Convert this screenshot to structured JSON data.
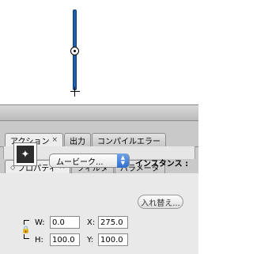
{
  "panel_tabs_top": [
    {
      "label": "アクション",
      "close": "×"
    },
    {
      "label": "出力"
    },
    {
      "label": "コンパイルエラー"
    }
  ],
  "panel_tabs_props": [
    {
      "label": "プロパティ",
      "close": "×",
      "active": true
    },
    {
      "label": "フィルタ"
    },
    {
      "label": "パラメータ"
    }
  ],
  "symbol_type": {
    "selected": "ムービーク..."
  },
  "instance": {
    "label": "インスタンス :"
  },
  "swap_button": {
    "label": "入れ替え..."
  },
  "transform": {
    "w_label": "W:",
    "w_value": "0.0",
    "x_label": "X:",
    "x_value": "275.0",
    "h_label": "H:",
    "h_value": "100.0",
    "y_label": "Y:",
    "y_value": "100.0"
  },
  "icons": {
    "symbol": "movieclip-symbol-icon",
    "lock": "lock-icon",
    "dropdown": "dropdown-arrows-icon",
    "registration": "registration-point-icon",
    "crosshair": "crosshair-icon"
  },
  "colors": {
    "selection_line": "#1f5fa8",
    "dropdown_accent": "#2d6fcf",
    "panel_bg": "#c9c9c9"
  }
}
